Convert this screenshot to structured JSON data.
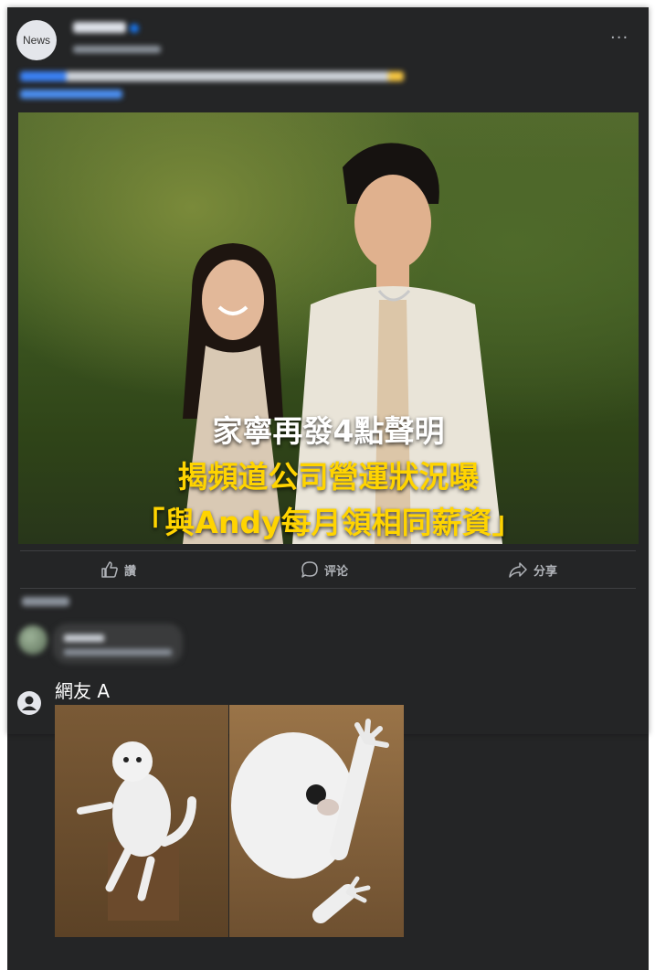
{
  "post": {
    "avatar_text": "News"
  },
  "photo": {
    "headline_line1": "家寧再發4點聲明",
    "headline_line2": "揭頻道公司營運狀況曝",
    "headline_line3": "「與Andy每月領相同薪資」"
  },
  "actions": {
    "like_label": "讚",
    "comment_label": "评论",
    "share_label": "分享"
  },
  "comment": {
    "user_name": "網友 A"
  },
  "colors": {
    "background": "#242526",
    "text_secondary": "#b0b3b8",
    "headline_white": "#ffffff",
    "headline_yellow": "#ffd400",
    "link_blue": "#1877f2"
  }
}
